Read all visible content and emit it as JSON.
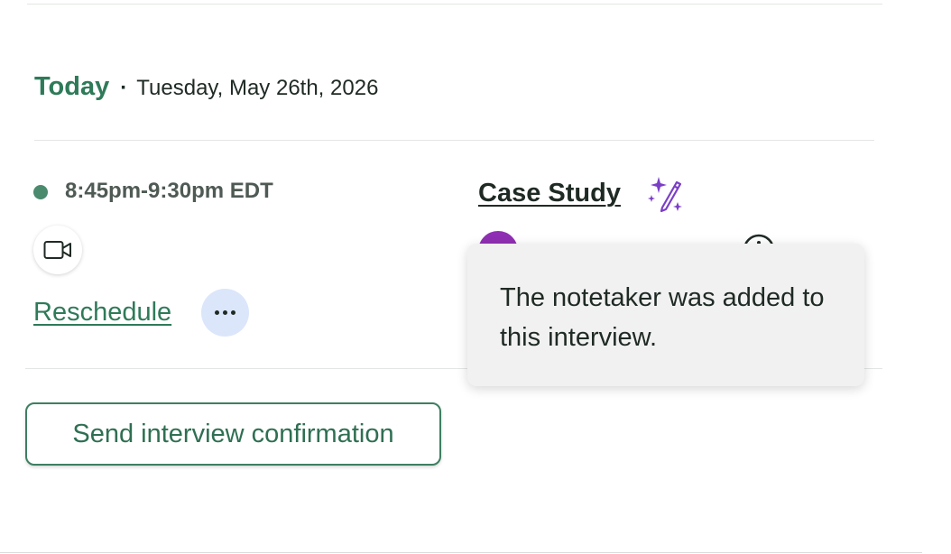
{
  "day": {
    "label": "Today",
    "separator": "·",
    "date": "Tuesday, May 26th, 2026"
  },
  "event": {
    "time": "8:45pm-9:30pm EDT",
    "status_color": "#4a8a6d",
    "video_icon": "video-camera-icon",
    "reschedule_label": "Reschedule",
    "more_icon": "more-dots-icon",
    "title": "Case Study",
    "title_icon": "sparkle-pencil-icon",
    "interviewer": {
      "avatar_color": "#8f2fb3",
      "info_icon": "info-icon"
    }
  },
  "tooltip": {
    "text": "The notetaker was added to this interview."
  },
  "actions": {
    "confirm_label": "Send interview confirmation"
  },
  "colors": {
    "accent": "#2f7a59",
    "sparkle": "#7b3fc7",
    "more_button_bg": "#dbe6fb"
  }
}
